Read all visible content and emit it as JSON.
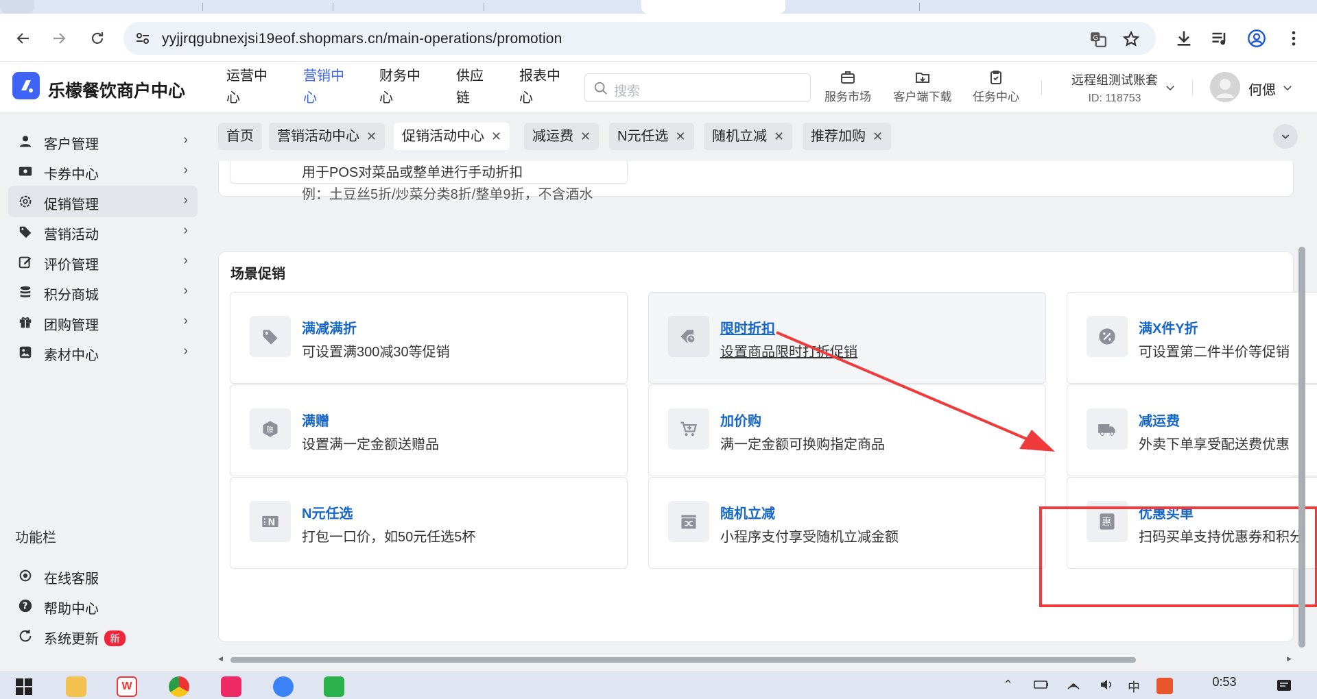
{
  "browser": {
    "url": "yyjjrqgubnexjsi19eof.shopmars.cn/main-operations/promotion"
  },
  "header": {
    "brand": "乐檬餐饮商户中心",
    "nav": [
      {
        "line1": "运营中",
        "line2": "心"
      },
      {
        "line1": "营销中",
        "line2": "心",
        "active": true
      },
      {
        "line1": "财务中",
        "line2": "心"
      },
      {
        "line1": "供应",
        "line2": "链"
      },
      {
        "line1": "报表中",
        "line2": "心"
      }
    ],
    "search_placeholder": "搜索",
    "tools": [
      "服务市场",
      "客户端下载",
      "任务中心"
    ],
    "account_name": "远程组测试账套",
    "account_id": "ID: 118753",
    "user": "何偲"
  },
  "sidebar": {
    "items": [
      {
        "label": "客户管理",
        "icon": "user-icon"
      },
      {
        "label": "卡券中心",
        "icon": "ticket-icon"
      },
      {
        "label": "促销管理",
        "icon": "gear-icon",
        "active": true
      },
      {
        "label": "营销活动",
        "icon": "tag-icon"
      },
      {
        "label": "评价管理",
        "icon": "edit-icon"
      },
      {
        "label": "积分商城",
        "icon": "coins-icon"
      },
      {
        "label": "团购管理",
        "icon": "gift-icon"
      },
      {
        "label": "素材中心",
        "icon": "image-icon"
      }
    ],
    "section_title": "功能栏",
    "footer": [
      {
        "label": "在线客服",
        "icon": "headset-icon"
      },
      {
        "label": "帮助中心",
        "icon": "help-icon"
      },
      {
        "label": "系统更新",
        "icon": "refresh-icon",
        "badge": "新"
      }
    ]
  },
  "page_tabs": [
    {
      "label": "首页",
      "closable": false
    },
    {
      "label": "营销活动中心",
      "closable": true
    },
    {
      "label": "促销活动中心",
      "closable": true,
      "active": true
    },
    {
      "label": "减运费",
      "closable": true
    },
    {
      "label": "N元任选",
      "closable": true
    },
    {
      "label": "随机立减",
      "closable": true
    },
    {
      "label": "推荐加购",
      "closable": true
    }
  ],
  "top_card": {
    "desc1": "用于POS对菜品或整单进行手动折扣",
    "desc2": "例：土豆丝5折/炒菜分类8折/整单9折，不含酒水"
  },
  "scene_section": {
    "title": "场景促销",
    "cards": [
      {
        "title": "满减满折",
        "desc": "可设置满300减30等促销",
        "icon": "tag-icon"
      },
      {
        "title": "限时折扣",
        "desc": "设置商品限时打折促销",
        "icon": "clock-tag-icon",
        "hover": true
      },
      {
        "title": "满X件Y折",
        "desc": "可设置第二件半价等促销",
        "icon": "percent-icon"
      },
      {
        "title": "满赠",
        "desc": "设置满一定金额送赠品",
        "icon": "gift-hex-icon"
      },
      {
        "title": "加价购",
        "desc": "满一定金额可换购指定商品",
        "icon": "cart-icon"
      },
      {
        "title": "减运费",
        "desc": "外卖下单享受配送费优惠",
        "icon": "truck-icon"
      },
      {
        "title": "N元任选",
        "desc": "打包一口价，如50元任选5杯",
        "icon": "n-icon"
      },
      {
        "title": "随机立减",
        "desc": "小程序支付享受随机立减金额",
        "icon": "shuffle-icon"
      },
      {
        "title": "优惠买单",
        "desc": "扫码买单支持优惠券和积分",
        "icon": "hui-icon"
      }
    ]
  },
  "taskbar": {
    "time": "0:53",
    "tray_ime": "中"
  },
  "colors": {
    "accent": "#3a63f0",
    "link": "#1667c8",
    "annotation": "#ef3b3b",
    "badge": "#f0253a"
  }
}
